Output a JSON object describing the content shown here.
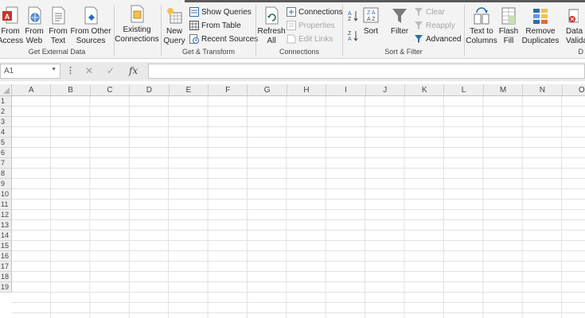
{
  "ribbon": {
    "get_external_data": {
      "label": "Get External Data",
      "from_access": "From\nAccess",
      "from_web": "From\nWeb",
      "from_text": "From\nText",
      "from_other_sources": "From Other\nSources"
    },
    "existing_connections": "Existing\nConnections",
    "get_transform": {
      "label": "Get & Transform",
      "new_query": "New\nQuery",
      "show_queries": "Show Queries",
      "from_table": "From Table",
      "recent_sources": "Recent Sources"
    },
    "connections": {
      "label": "Connections",
      "refresh_all": "Refresh\nAll",
      "connections": "Connections",
      "properties": "Properties",
      "edit_links": "Edit Links"
    },
    "sort_filter": {
      "label": "Sort & Filter",
      "sort": "Sort",
      "filter": "Filter",
      "clear": "Clear",
      "reapply": "Reapply",
      "advanced": "Advanced",
      "az": "A\nZ",
      "za": "Z\nA"
    },
    "data_tools": {
      "label": "D",
      "text_to_columns": "Text to\nColumns",
      "flash_fill": "Flash\nFill",
      "remove_duplicates": "Remove\nDuplicates",
      "data_validation": "Data\nValidation"
    }
  },
  "formula_bar": {
    "name_box": "A1",
    "fx": "fx",
    "cancel": "✕",
    "enter": "✓",
    "value": ""
  },
  "grid": {
    "columns": [
      "A",
      "B",
      "C",
      "D",
      "E",
      "F",
      "G",
      "H",
      "I",
      "J",
      "K",
      "L",
      "M",
      "N",
      "O"
    ],
    "rows": [
      "1",
      "2",
      "3",
      "4",
      "5",
      "6",
      "7",
      "8",
      "9",
      "10",
      "11",
      "12",
      "13",
      "14",
      "15",
      "16",
      "17",
      "18",
      "19"
    ]
  },
  "colors": {
    "ribbon_bg": "#f3f3f3",
    "access_red": "#c4342a",
    "excel_green": "#217346",
    "accent_blue": "#2b6cb0"
  }
}
